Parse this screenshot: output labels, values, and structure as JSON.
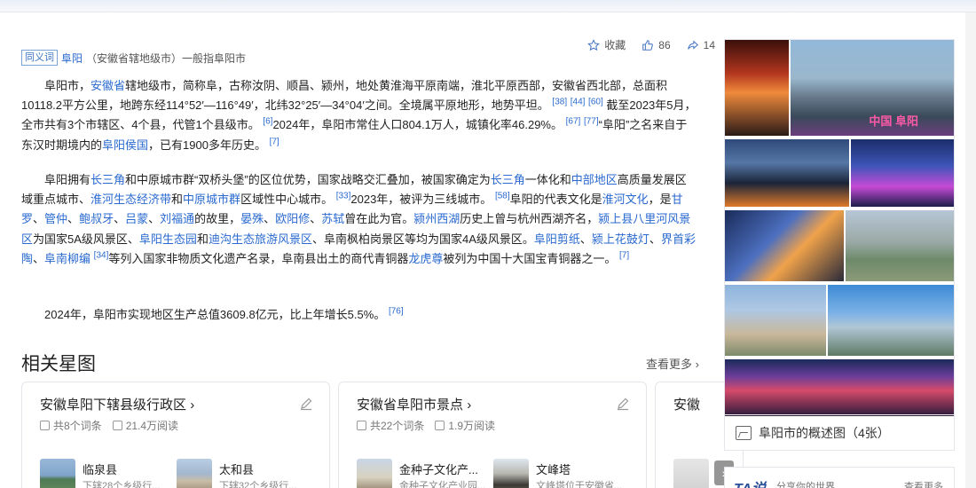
{
  "actions": {
    "collect": "收藏",
    "likes": "86",
    "shares": "14"
  },
  "synonym": {
    "badge": "同义词",
    "link": "阜阳",
    "note": "（安徽省辖地级市）一般指阜阳市"
  },
  "p1": {
    "s1": "阜阳市，",
    "l1": "安徽省",
    "s2": "辖地级市，简称阜，古称汝阴、顺昌、颍州，地处黄淮海平原南端，淮北平原西部，安徽省西北部，总面积10118.2平方公里，地跨东经114°52′—116°49′，北纬32°25′—34°04′之间。全境属平原地形，地势平坦。",
    "r1": "[38]",
    "r2": "[44]",
    "r3": "[60]",
    "s3": "截至2023年5月，全市共有3个市辖区、4个县，代管1个县级市。",
    "r4": "[6]",
    "s4": "2024年，阜阳市常住人口804.1万人，城镇化率46.29%。",
    "r5": "[67]",
    "r6": "[77]",
    "s5": "“阜阳”之名来自于东汉时期境内的",
    "l2": "阜阳侯国",
    "s6": "，已有1900多年历史。",
    "r7": "[7]"
  },
  "p2": {
    "s1": "阜阳拥有",
    "l1": "长三角",
    "s2": "和中原城市群“双桥头堡”的区位优势，国家战略交汇叠加，被国家确定为",
    "l2": "长三角",
    "s3": "一体化和",
    "l3": "中部地区",
    "s4": "高质量发展区域重点城市、",
    "l4": "淮河生态经济带",
    "s5": "和",
    "l5": "中原城市群",
    "s6": "区域性中心城市。",
    "r1": "[33]",
    "s7": "2023年，被评为三线城市。",
    "r2": "[58]",
    "s8": "阜阳的代表文化是",
    "l6": "淮河文化",
    "s9": "，是",
    "l7": "甘罗",
    "s10": "、",
    "l8": "管仲",
    "s11": "、",
    "l9": "鲍叔牙",
    "s12": "、",
    "l10": "吕蒙",
    "s13": "、",
    "l11": "刘福通",
    "s14": "的故里，",
    "l12": "晏殊",
    "s15": "、",
    "l13": "欧阳修",
    "s16": "、",
    "l14": "苏轼",
    "s17": "曾在此为官。",
    "l15": "颍州西湖",
    "s18": "历史上曾与杭州西湖齐名，",
    "l16": "颍上县八里河风景区",
    "s19": "为国家5A级风景区、",
    "l17": "阜阳生态园",
    "s20": "和",
    "l18": "迪沟生态旅游风景区",
    "s21": "、阜南枫柏岗景区等均为国家4A级风景区。",
    "l19": "阜阳剪纸",
    "s22": "、",
    "l20": "颍上花鼓灯",
    "s23": "、",
    "l21": "界首彩陶",
    "s24": "、",
    "l22": "阜南柳编",
    "r3": "[34]",
    "s25": "等列入国家非物质文化遗产名录，阜南县出土的商代青铜器",
    "l23": "龙虎尊",
    "s26": "被列为中国十大国宝青铜器之一。",
    "r4": "[7]"
  },
  "p3": {
    "s1": "2024年，阜阳市实现地区生产总值3609.8亿元，比上年增长5.5%。",
    "r1": "[76]"
  },
  "section": {
    "title": "相关星图",
    "more": "查看更多"
  },
  "cards": [
    {
      "title": "安徽阜阳下辖县级行政区",
      "count": "共8个词条",
      "reads": "21.4万阅读",
      "items": [
        {
          "name": "临泉县",
          "desc": "下辖28个乡级行..."
        },
        {
          "name": "太和县",
          "desc": "下辖32个乡级行..."
        }
      ]
    },
    {
      "title": "安徽省阜阳市景点",
      "count": "共22个词条",
      "reads": "1.9万阅读",
      "items": [
        {
          "name": "金种子文化产...",
          "desc": "金种子文化产业园..."
        },
        {
          "name": "文峰塔",
          "desc": "文峰塔位于安徽省..."
        }
      ]
    },
    {
      "title": "安徽"
    }
  ],
  "gallery": {
    "overlay": "中国 阜阳",
    "caption": "阜阳市的概述图（4张）"
  },
  "ta": {
    "logo": "TA说",
    "sub": "分享你的世界",
    "more": "查看更多"
  }
}
